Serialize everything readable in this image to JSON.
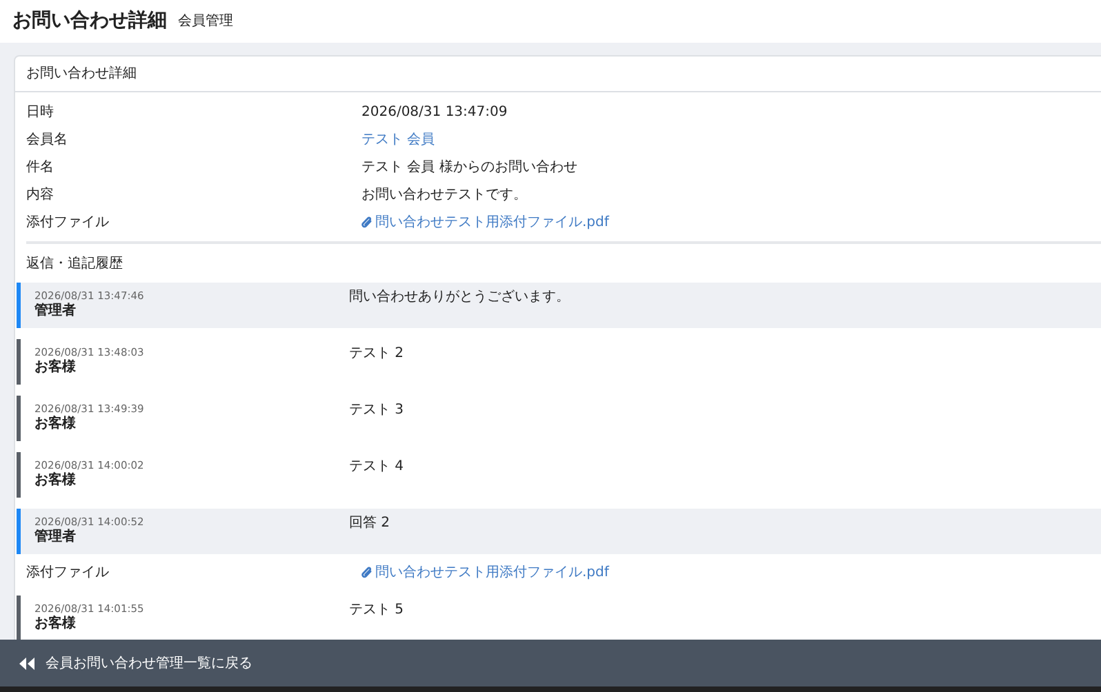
{
  "header": {
    "title": "お問い合わせ詳細",
    "subtitle": "会員管理"
  },
  "card": {
    "title": "お問い合わせ詳細",
    "fields": [
      {
        "kind": "text",
        "label": "日時",
        "value": "2026/08/31 13:47:09"
      },
      {
        "kind": "link",
        "label": "会員名",
        "value": "テスト 会員"
      },
      {
        "kind": "text",
        "label": "件名",
        "value": "テスト 会員 様からのお問い合わせ"
      },
      {
        "kind": "text",
        "label": "内容",
        "value": "お問い合わせテストです。"
      },
      {
        "kind": "file",
        "label": "添付ファイル",
        "value": "問い合わせテスト用添付ファイル.pdf"
      }
    ],
    "history_title": "返信・追記履歴",
    "history": [
      {
        "kind": "message",
        "highlighted": true,
        "color": "#1e88f5",
        "time": "2026/08/31 13:47:46",
        "author": "管理者",
        "text": "問い合わせありがとうございます。"
      },
      {
        "kind": "message",
        "highlighted": false,
        "color": "#5a6068",
        "time": "2026/08/31 13:48:03",
        "author": "お客様",
        "text": "テスト 2"
      },
      {
        "kind": "message",
        "highlighted": false,
        "color": "#5a6068",
        "time": "2026/08/31 13:49:39",
        "author": "お客様",
        "text": "テスト 3"
      },
      {
        "kind": "message",
        "highlighted": false,
        "color": "#5a6068",
        "time": "2026/08/31 14:00:02",
        "author": "お客様",
        "text": "テスト 4"
      },
      {
        "kind": "message",
        "highlighted": true,
        "color": "#1e88f5",
        "time": "2026/08/31 14:00:52",
        "author": "管理者",
        "text": "回答 2"
      },
      {
        "kind": "attachment",
        "label": "添付ファイル",
        "file": "問い合わせテスト用添付ファイル.pdf"
      },
      {
        "kind": "message",
        "highlighted": false,
        "color": "#5a6068",
        "time": "2026/08/31 14:01:55",
        "author": "お客様",
        "text": "テスト 5"
      }
    ]
  },
  "back_button": {
    "label": "会員お問い合わせ管理一覧に戻る"
  }
}
